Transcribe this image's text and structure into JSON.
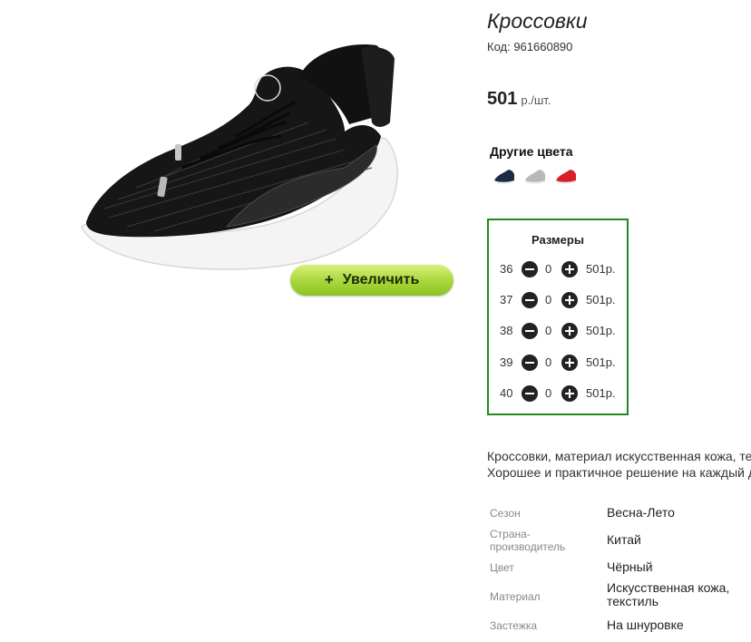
{
  "product": {
    "title": "Кроссовки",
    "code": "Код: 961660890",
    "price_value": "501",
    "price_unit": "р./шт."
  },
  "zoom_button": {
    "icon": "plus-icon",
    "label": "Увеличить",
    "background": "#a8d63a"
  },
  "other_colors": {
    "title": "Другие цвета",
    "swatches": [
      {
        "name": "navy",
        "color": "#1e2a44"
      },
      {
        "name": "grey",
        "color": "#b8b8bc"
      },
      {
        "name": "red",
        "color": "#d8202a"
      }
    ]
  },
  "sizes": {
    "title": "Размеры",
    "border_color": "#1f8a1f",
    "rows": [
      {
        "size": "36",
        "qty": "0",
        "price": "501р."
      },
      {
        "size": "37",
        "qty": "0",
        "price": "501р."
      },
      {
        "size": "38",
        "qty": "0",
        "price": "501р."
      },
      {
        "size": "39",
        "qty": "0",
        "price": "501р."
      },
      {
        "size": "40",
        "qty": "0",
        "price": "501р."
      }
    ]
  },
  "description": {
    "line1": "Кроссовки, материал искусственная кожа, текстиль.",
    "line2": "Хорошее и практичное решение на каждый день."
  },
  "properties": [
    {
      "key": "Сезон",
      "value": "Весна-Лето"
    },
    {
      "key": "Страна-производитель",
      "value": "Китай"
    },
    {
      "key": "Цвет",
      "value": "Чёрный"
    },
    {
      "key": "Материал",
      "value": "Искусственная кожа, текстиль"
    },
    {
      "key": "Застежка",
      "value": "На шнуровке"
    }
  ]
}
